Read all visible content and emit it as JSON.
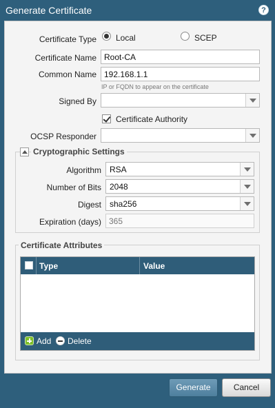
{
  "window": {
    "title": "Generate Certificate",
    "help_icon": "?"
  },
  "form": {
    "certificate_type": {
      "label": "Certificate Type",
      "options": [
        {
          "label": "Local",
          "selected": true
        },
        {
          "label": "SCEP",
          "selected": false
        }
      ]
    },
    "certificate_name": {
      "label": "Certificate Name",
      "value": "Root-CA"
    },
    "common_name": {
      "label": "Common Name",
      "value": "192.168.1.1",
      "hint": "IP or FQDN to appear on the certificate"
    },
    "signed_by": {
      "label": "Signed By",
      "value": ""
    },
    "certificate_authority": {
      "label": "Certificate Authority",
      "checked": true
    },
    "ocsp_responder": {
      "label": "OCSP Responder",
      "value": ""
    }
  },
  "crypto": {
    "legend": "Cryptographic Settings",
    "algorithm": {
      "label": "Algorithm",
      "value": "RSA"
    },
    "number_of_bits": {
      "label": "Number of Bits",
      "value": "2048"
    },
    "digest": {
      "label": "Digest",
      "value": "sha256"
    },
    "expiration": {
      "label": "Expiration (days)",
      "placeholder": "365"
    }
  },
  "attributes": {
    "legend": "Certificate Attributes",
    "columns": [
      "Type",
      "Value"
    ],
    "rows": [],
    "add_label": "Add",
    "delete_label": "Delete"
  },
  "buttons": {
    "generate": "Generate",
    "cancel": "Cancel"
  },
  "colors": {
    "titlebar": "#2e5f7c",
    "grid_header": "#2f5d79",
    "panel": "#f4f4f4"
  }
}
